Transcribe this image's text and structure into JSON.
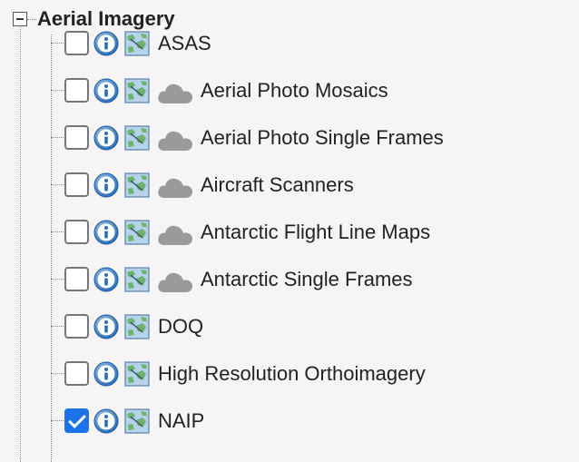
{
  "tree": {
    "root_label": "Aerial Imagery",
    "items": [
      {
        "label": "ASAS",
        "checked": false,
        "cloud": false
      },
      {
        "label": "Aerial Photo Mosaics",
        "checked": false,
        "cloud": true
      },
      {
        "label": "Aerial Photo Single Frames",
        "checked": false,
        "cloud": true
      },
      {
        "label": "Aircraft Scanners",
        "checked": false,
        "cloud": true
      },
      {
        "label": "Antarctic Flight Line Maps",
        "checked": false,
        "cloud": true
      },
      {
        "label": "Antarctic Single Frames",
        "checked": false,
        "cloud": true
      },
      {
        "label": "DOQ",
        "checked": false,
        "cloud": false
      },
      {
        "label": "High Resolution Orthoimagery",
        "checked": false,
        "cloud": false
      },
      {
        "label": "NAIP",
        "checked": true,
        "cloud": false
      }
    ]
  },
  "icons": {
    "collapse": "minus-box-icon",
    "info": "info-icon",
    "map": "map-icon",
    "cloud": "cloud-icon"
  },
  "colors": {
    "checkbox_checked": "#1a73e8",
    "info_icon": "#2d6fb7",
    "cloud_icon": "#9a9a9a",
    "map_icon_bg": "#b6d3ec",
    "map_icon_land": "#6cb36b"
  }
}
